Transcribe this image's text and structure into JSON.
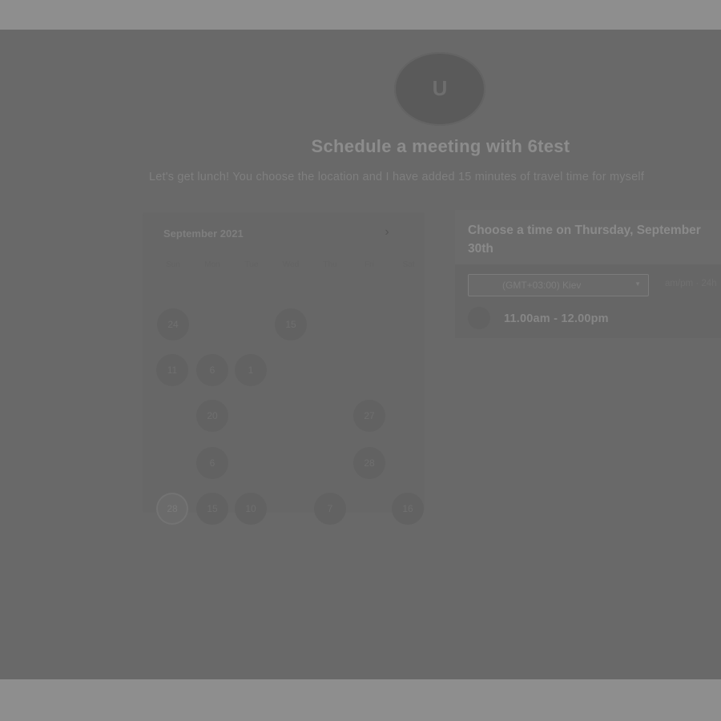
{
  "host": {
    "avatar_initial": "U"
  },
  "header": {
    "title": "Schedule a meeting with 6test",
    "description": "Let's get lunch! You choose the location and I have added 15 minutes of travel time for myself"
  },
  "calendar": {
    "month_label": "September 2021",
    "next_icon": "chevron-right-icon",
    "weekdays": [
      "Sun",
      "Mon",
      "Tue",
      "Wed",
      "Thu",
      "Fri",
      "Sat"
    ],
    "available_days": [
      {
        "label": "24"
      },
      {
        "label": "15"
      },
      {
        "label": "11"
      },
      {
        "label": "6"
      },
      {
        "label": "1"
      },
      {
        "label": "20"
      },
      {
        "label": "27"
      },
      {
        "label": "6"
      },
      {
        "label": "28"
      },
      {
        "label": "28"
      },
      {
        "label": "15"
      },
      {
        "label": "10"
      },
      {
        "label": "7"
      },
      {
        "label": "16"
      }
    ],
    "selected_day": "28"
  },
  "time_panel": {
    "heading": "Choose a time on Thursday, September 30th",
    "timezone": "(GMT+03:00) Kiev",
    "format_toggle": "am/pm · 24h",
    "slots": [
      {
        "label": "11.00am - 12.00pm"
      }
    ]
  }
}
